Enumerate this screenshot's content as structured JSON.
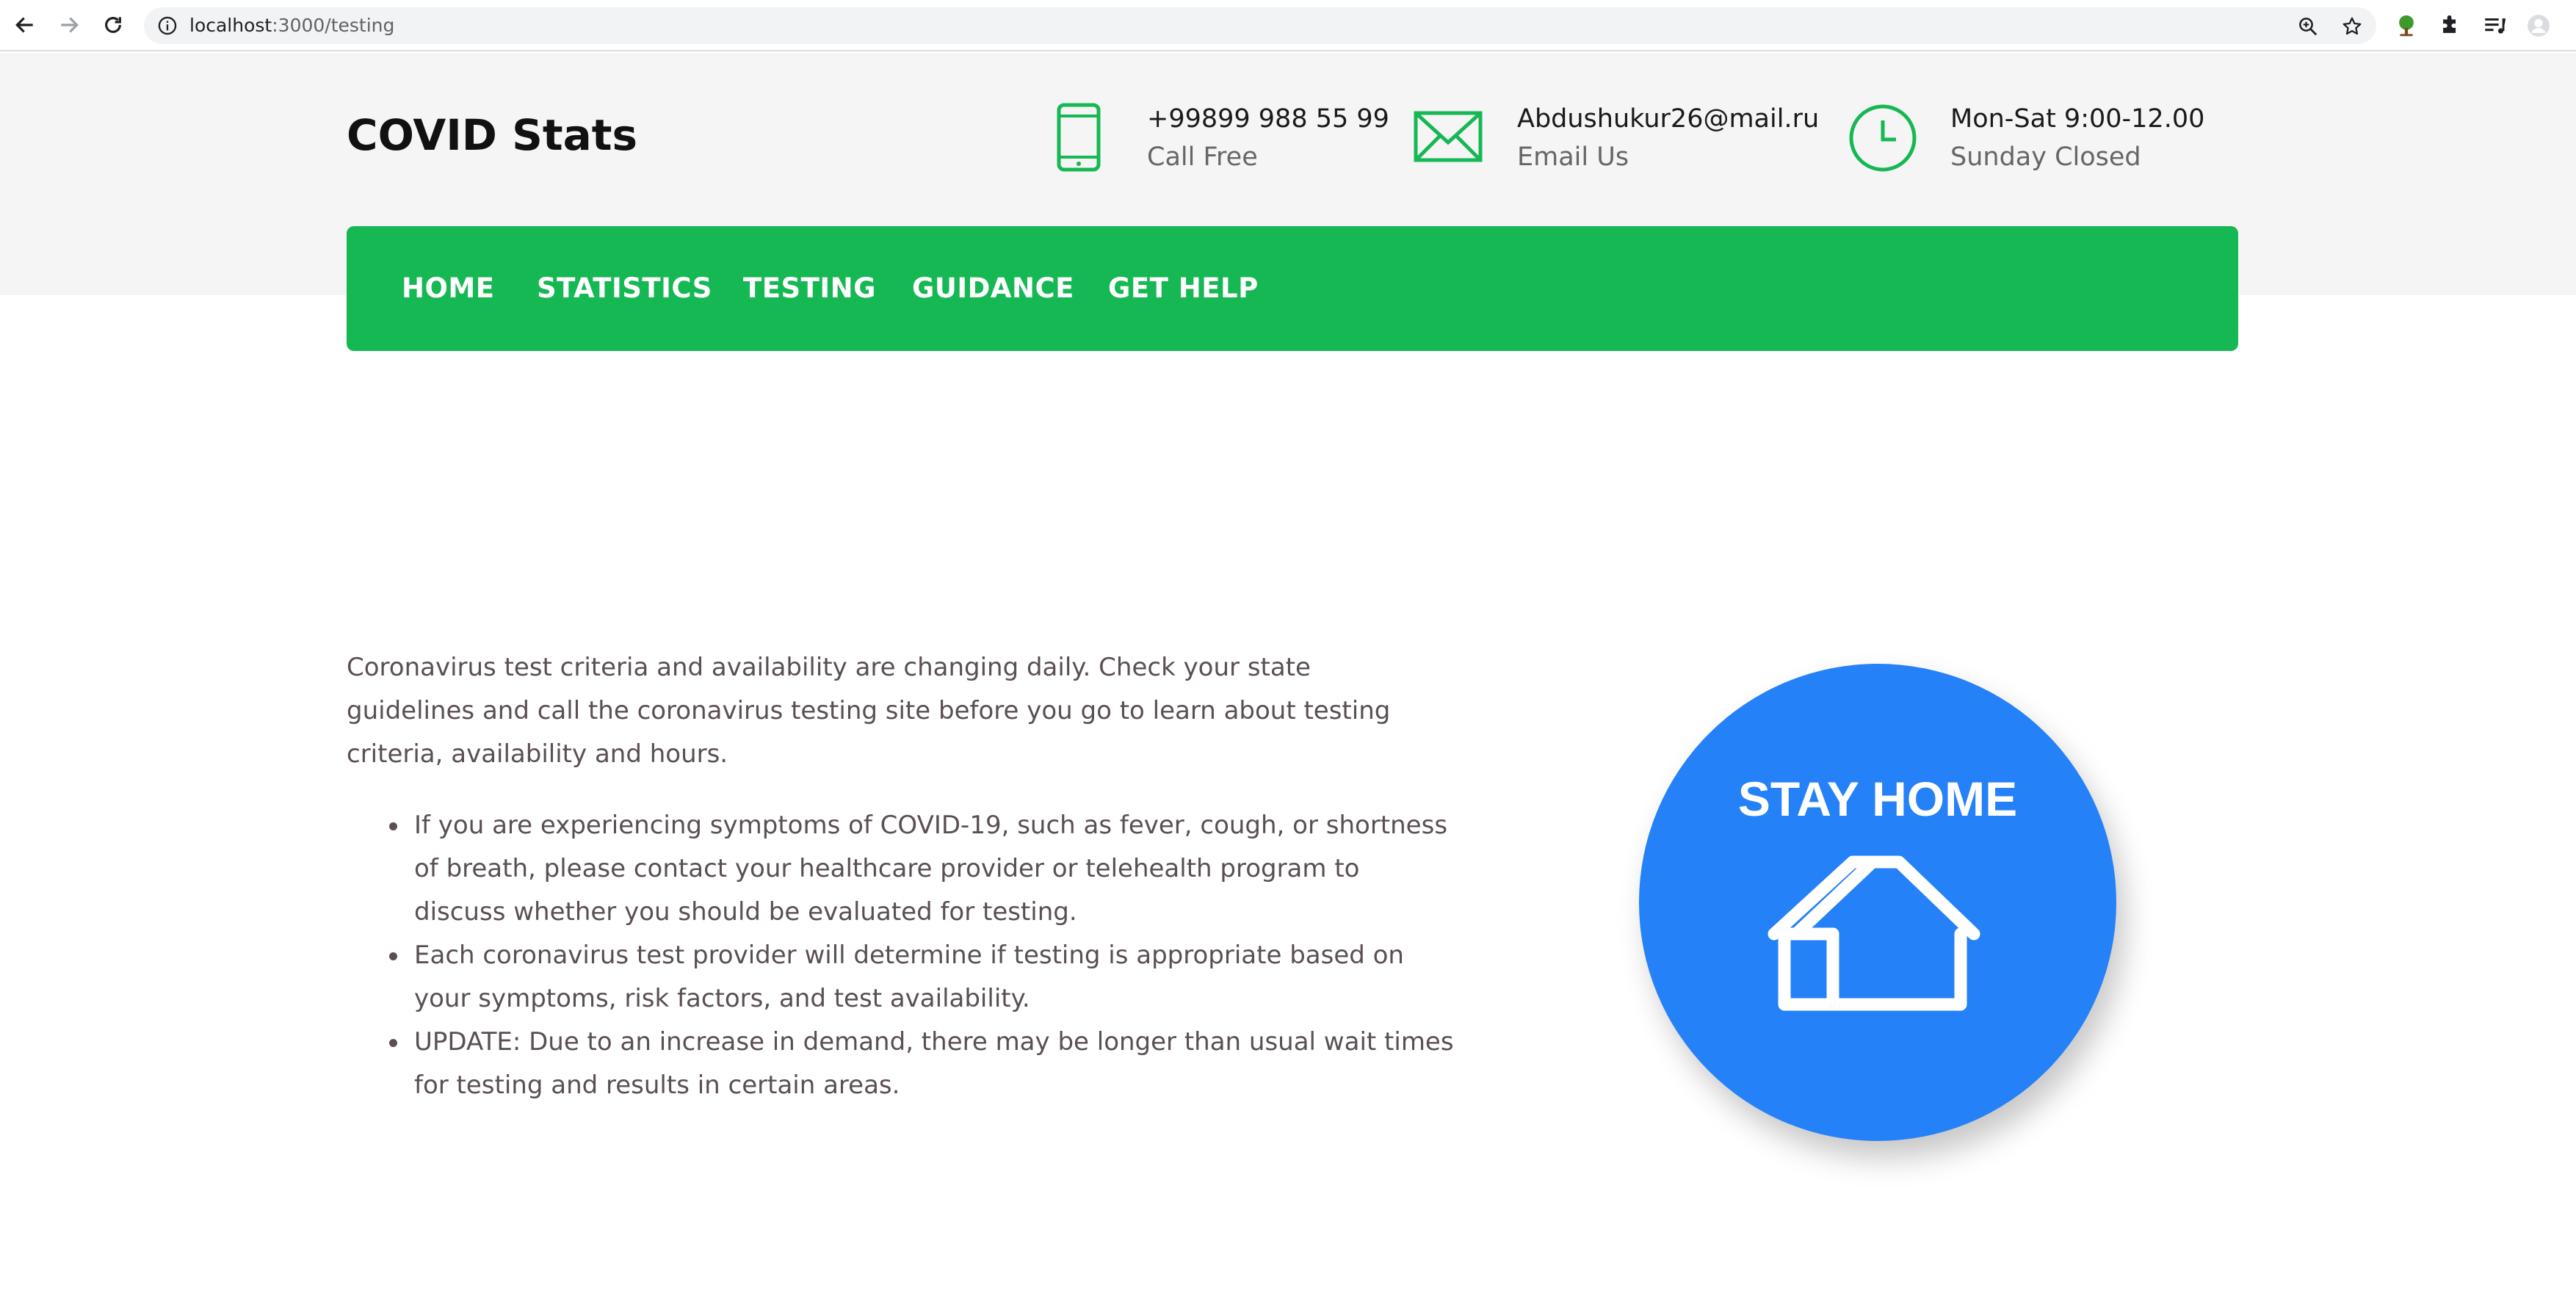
{
  "browser": {
    "url_host": "localhost",
    "url_path": ":3000/testing"
  },
  "header": {
    "logo": "COVID Stats",
    "contacts": [
      {
        "icon": "phone-icon",
        "main": "+99899 988 55 99",
        "sub": "Call Free"
      },
      {
        "icon": "mail-icon",
        "main": "Abdushukur26@mail.ru",
        "sub": "Email Us"
      },
      {
        "icon": "clock-icon",
        "main": "Mon-Sat 9:00-12.00",
        "sub": "Sunday Closed"
      }
    ]
  },
  "nav": {
    "items": [
      "HOME",
      "STATISTICS",
      "TESTING",
      "GUIDANCE",
      "GET HELP"
    ]
  },
  "content": {
    "intro": "Coronavirus test criteria and availability are changing daily. Check your state guidelines and call the coronavirus testing site before you go to learn about testing criteria, availability and hours.",
    "bullets": [
      "If you are experiencing symptoms of COVID-19, such as fever, cough, or shortness of breath, please contact your healthcare provider or telehealth program to discuss whether you should be evaluated for testing.",
      "Each coronavirus test provider will determine if testing is appropriate based on your symptoms, risk factors, and test availability.",
      "UPDATE: Due to an increase in demand, there may be longer than usual wait times for testing and results in certain areas."
    ]
  },
  "badge": {
    "text": "STAY HOME",
    "icon": "house-icon"
  },
  "colors": {
    "accent_green": "#16b853",
    "badge_blue": "#2581f7",
    "header_bg": "#f5f5f5"
  }
}
